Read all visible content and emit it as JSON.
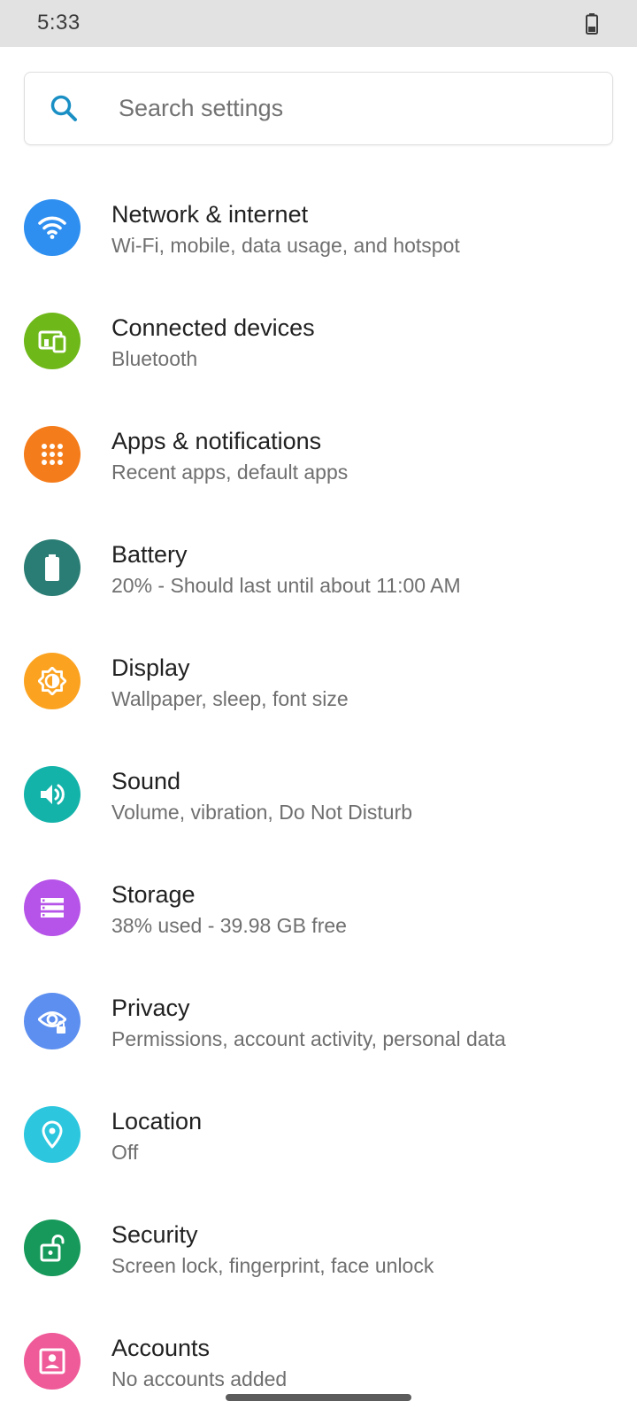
{
  "status_bar": {
    "time": "5:33",
    "battery_icon": "battery-icon"
  },
  "search": {
    "icon": "search-icon",
    "placeholder": "Search settings",
    "value": "",
    "accent_color": "#1a8fc4"
  },
  "settings": {
    "items": [
      {
        "title": "Network & internet",
        "subtitle": "Wi-Fi, mobile, data usage, and hotspot",
        "icon": "wifi-icon",
        "color": "#2e8ff0"
      },
      {
        "title": "Connected devices",
        "subtitle": "Bluetooth",
        "icon": "devices-icon",
        "color": "#6fb81a"
      },
      {
        "title": "Apps & notifications",
        "subtitle": "Recent apps, default apps",
        "icon": "apps-grid-icon",
        "color": "#f57c1a"
      },
      {
        "title": "Battery",
        "subtitle": "20% - Should last until about 11:00 AM",
        "icon": "battery-icon",
        "color": "#2a7d74"
      },
      {
        "title": "Display",
        "subtitle": "Wallpaper, sleep, font size",
        "icon": "brightness-icon",
        "color": "#fba321"
      },
      {
        "title": "Sound",
        "subtitle": "Volume, vibration, Do Not Disturb",
        "icon": "volume-icon",
        "color": "#13b3aa"
      },
      {
        "title": "Storage",
        "subtitle": "38% used - 39.98 GB free",
        "icon": "storage-icon",
        "color": "#b653e8"
      },
      {
        "title": "Privacy",
        "subtitle": "Permissions, account activity, personal data",
        "icon": "privacy-eye-icon",
        "color": "#5d8ff0"
      },
      {
        "title": "Location",
        "subtitle": "Off",
        "icon": "location-pin-icon",
        "color": "#2cc6de"
      },
      {
        "title": "Security",
        "subtitle": "Screen lock, fingerprint, face unlock",
        "icon": "unlock-icon",
        "color": "#16995a"
      },
      {
        "title": "Accounts",
        "subtitle": "No accounts added",
        "icon": "account-icon",
        "color": "#ef5a98"
      }
    ]
  },
  "nav": {
    "handle": "gesture-handle"
  }
}
